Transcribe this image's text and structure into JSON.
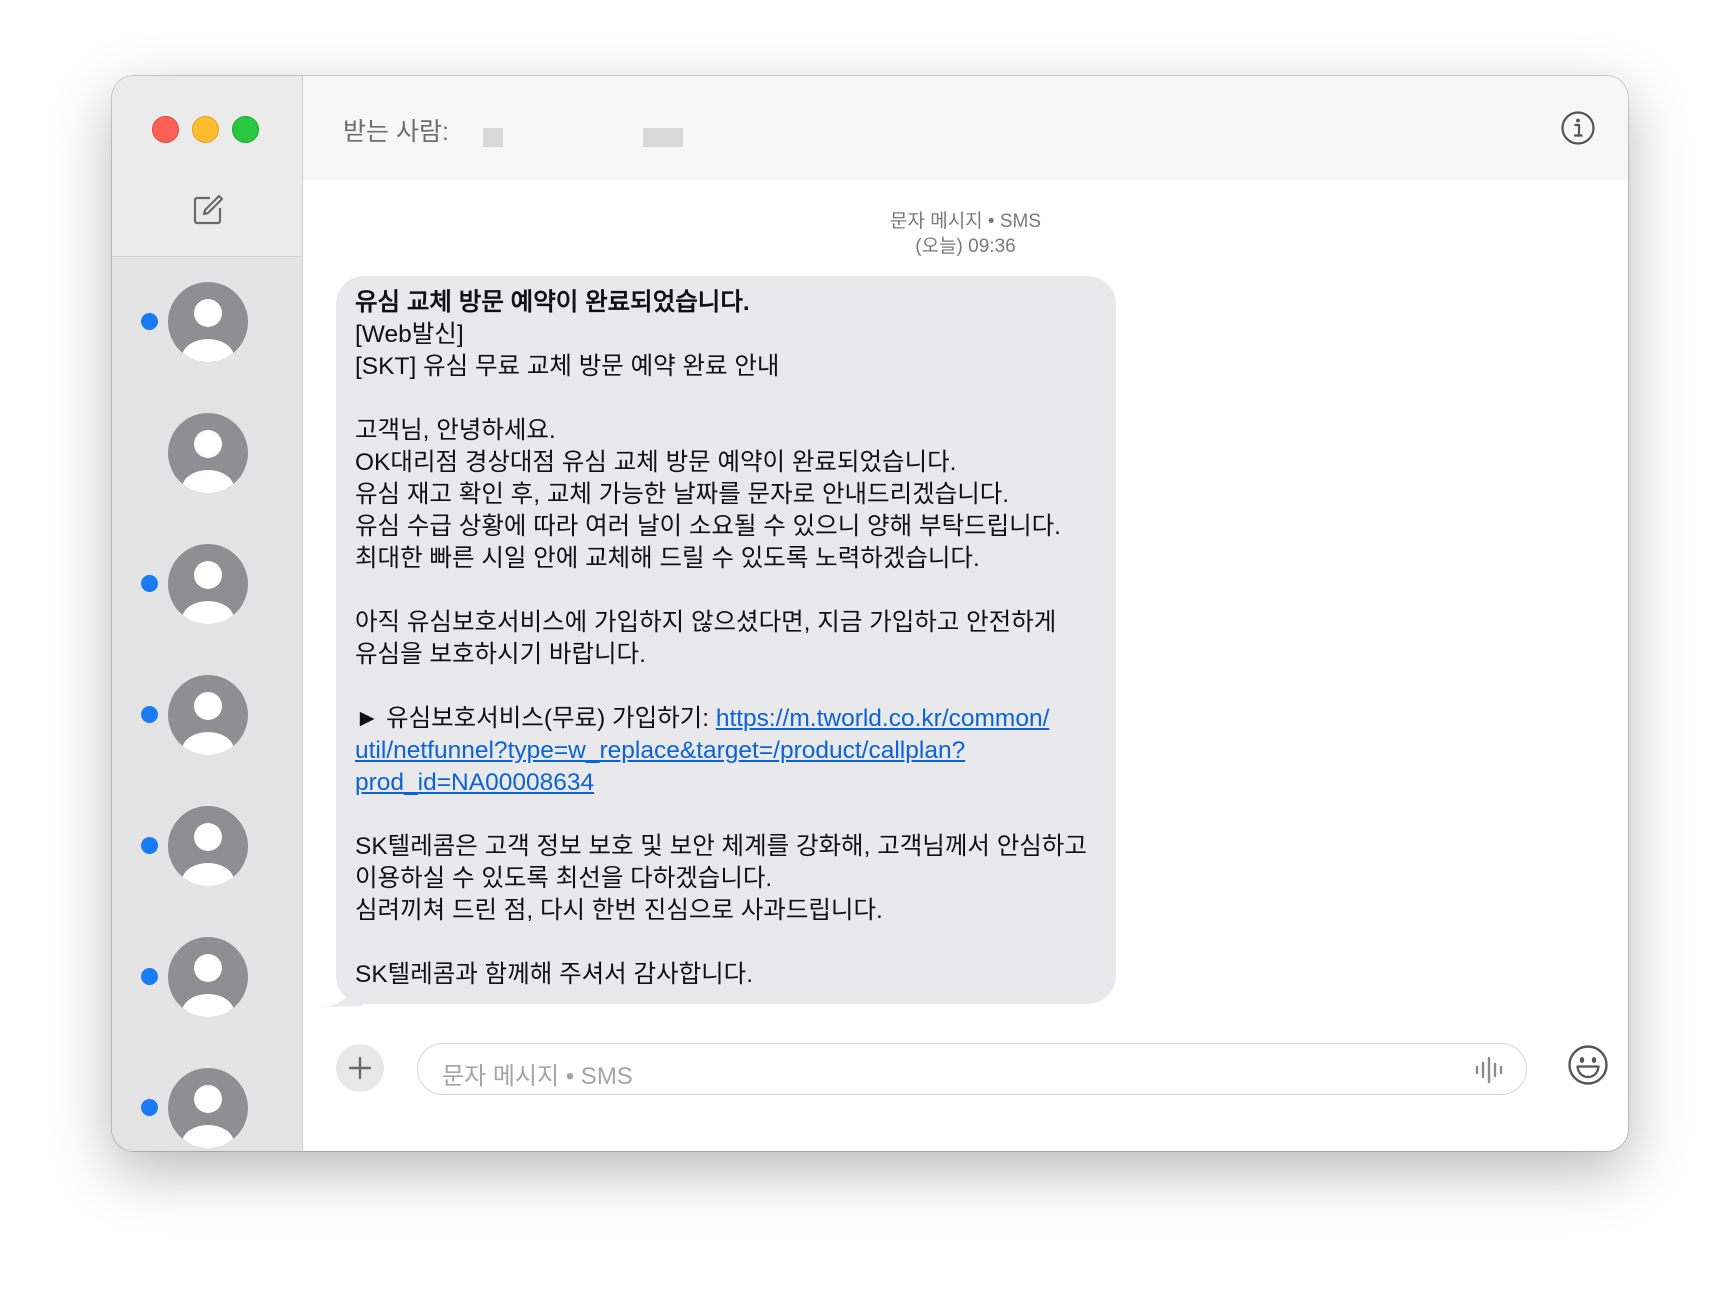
{
  "header": {
    "to_label": "받는 사람:"
  },
  "conversation": {
    "service": "문자 메시지 • SMS",
    "timestamp": "(오늘) 09:36"
  },
  "message": {
    "lines": [
      "유심 교체 방문 예약이 완료되었습니다.",
      "[Web발신]",
      "[SKT] 유심 무료 교체 방문 예약 완료 안내",
      "",
      "고객님, 안녕하세요.",
      "OK대리점 경상대점 유심 교체 방문 예약이 완료되었습니다.",
      "유심 재고 확인 후, 교체 가능한 날짜를 문자로 안내드리겠습니다.",
      "유심 수급 상황에 따라 여러 날이 소요될 수 있으니 양해 부탁드립니다.",
      "최대한 빠른 시일 안에 교체해 드릴 수 있도록 노력하겠습니다.",
      "",
      "아직 유심보호서비스에 가입하지 않으셨다면, 지금 가입하고 안전하게",
      "유심을 보호하시기 바랍니다.",
      "",
      "► 유심보호서비스(무료) 가입하기: "
    ],
    "link_lines": [
      "https://m.tworld.co.kr/common/",
      "util/netfunnel?type=w_replace&target=/product/callplan?",
      "prod_id=NA00008634"
    ],
    "tail_lines": [
      "",
      "SK텔레콤은 고객 정보 보호 및 보안 체계를 강화해, 고객님께서 안심하고",
      "이용하실 수 있도록 최선을 다하겠습니다.",
      "심려끼쳐 드린 점, 다시 한번 진심으로 사과드립니다.",
      "",
      "SK텔레콤과 함께해 주셔서 감사합니다."
    ]
  },
  "composer": {
    "placeholder": "문자 메시지 • SMS"
  },
  "sidebar": {
    "conversations": [
      {
        "unread": true
      },
      {
        "unread": false
      },
      {
        "unread": true
      },
      {
        "unread": true
      },
      {
        "unread": true
      },
      {
        "unread": true
      },
      {
        "unread": true
      }
    ]
  },
  "icons": {
    "compose": "compose-icon",
    "info": "info-icon",
    "plus": "plus-icon",
    "audio": "audio-waveform-icon",
    "emoji": "emoji-icon",
    "avatar": "person-avatar-icon"
  },
  "colors": {
    "unread_dot": "#1a7cf5",
    "link": "#0a63d8",
    "bubble": "#e9e9eb",
    "close": "#fe5f57",
    "minimize": "#febc2e",
    "maximize": "#28c840"
  }
}
